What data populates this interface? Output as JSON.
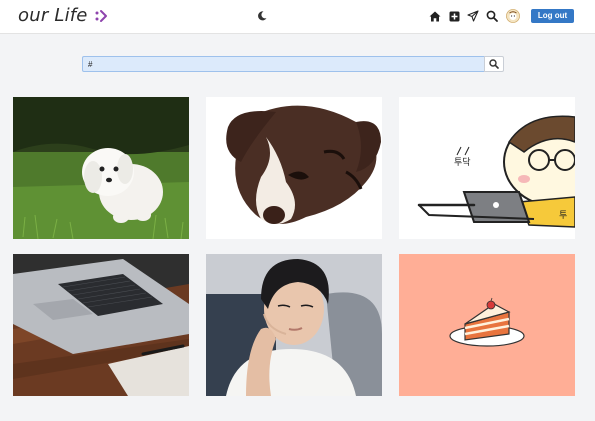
{
  "header": {
    "logo_text": "our Life",
    "logo_mark": "heart-arrow-icon",
    "theme_icon": "moon-icon",
    "nav_icons": [
      "home-icon",
      "add-box-icon",
      "paper-plane-icon",
      "search-icon",
      "avatar"
    ],
    "logout_label": "Log out"
  },
  "search": {
    "value": "#",
    "button_icon": "search-icon"
  },
  "posts": [
    {
      "name": "post-white-puppy",
      "alt": "white puppy on grass"
    },
    {
      "name": "post-dog-illustration",
      "alt": "brown dog illustration"
    },
    {
      "name": "post-cartoon-laptop",
      "alt": "cartoon character with laptop",
      "texts": [
        "투닥",
        "투"
      ]
    },
    {
      "name": "post-laptop-desk",
      "alt": "laptop on wooden desk"
    },
    {
      "name": "post-young-man",
      "alt": "young man portrait"
    },
    {
      "name": "post-cake-slice",
      "alt": "cake slice on plate"
    }
  ],
  "colors": {
    "accent": "#3478c6",
    "search_bg": "#dceafb",
    "page_bg": "#f3f4f6",
    "cake_bg": "#ffae96"
  }
}
